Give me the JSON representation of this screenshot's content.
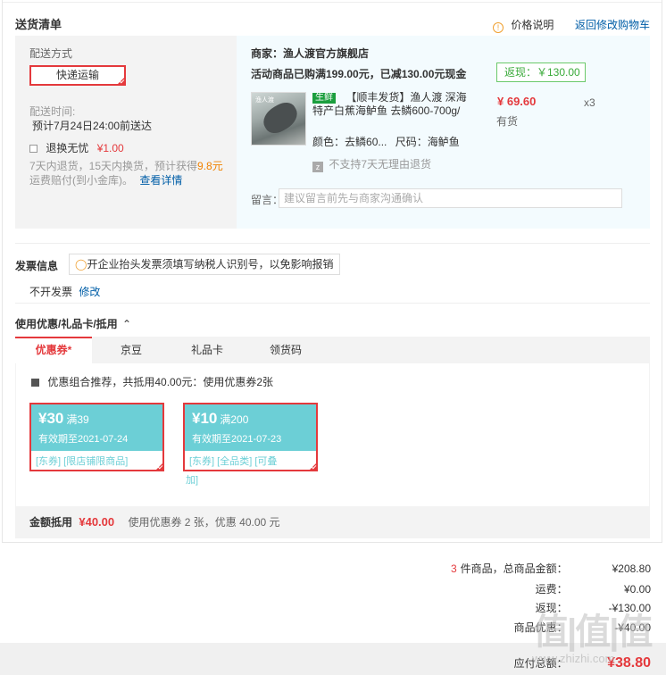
{
  "delivery": {
    "title": "送货清单",
    "price_explain": "价格说明",
    "back_to_cart": "返回修改购物车",
    "ship_method_label": "配送方式",
    "ship_method": "快递运输",
    "ship_time_label": "配送时间:",
    "ship_time": "预计7月24日24:00前送达",
    "worry_free": "退换无忧",
    "worry_free_price": "¥1.00",
    "worry_free_desc_1": "7天内退货，15天内换货，预计获得",
    "worry_free_amount": "9.8元",
    "worry_free_desc_2": "运费赔付(到小金库)。",
    "view_details": "查看详情"
  },
  "merchant": {
    "label": "商家：渔人渡官方旗舰店",
    "promo": "活动商品已购满199.00元，已减130.00元现金",
    "rebate": "返现：￥130.00",
    "product_image_text": "渔人渡",
    "product_tag": "生鲜",
    "product_title_1": "【顺丰发货】渔人渡 深海",
    "product_title_2": "特产白蕉海鲈鱼 去鳞600-700g/",
    "price": "¥ 69.60",
    "quantity": "x3",
    "stock": "有货",
    "color_label": "颜色：",
    "color_value": "去鳞60...",
    "size_label": "尺码：",
    "size_value": "海鲈鱼",
    "no_return": "不支持7天无理由退货",
    "note_label": "留言：",
    "note_placeholder": "建议留言前先与商家沟通确认"
  },
  "invoice": {
    "title": "发票信息",
    "tip": "开企业抬头发票须填写纳税人识别号，以免影响报销",
    "value": "不开发票",
    "modify": "修改"
  },
  "discount": {
    "title": "使用优惠/礼品卡/抵用",
    "tabs": [
      "优惠券*",
      "京豆",
      "礼品卡",
      "领货码"
    ],
    "combo_text": "优惠组合推荐，共抵用40.00元：使用优惠券2张",
    "coupons": [
      {
        "amount": "¥30",
        "cond": "满39",
        "expiry": "有效期至2021-07-24",
        "tags": "[东券]  [限店铺限商品]",
        "tags2": ""
      },
      {
        "amount": "¥10",
        "cond": "满200",
        "expiry": "有效期至2021-07-23",
        "tags": "[东券]  [全品类]  [可叠",
        "tags2": "加]"
      }
    ],
    "sum_label": "金额抵用",
    "sum_value": "¥40.00",
    "sum_desc": "使用优惠券 2 张，优惠 40.00 元"
  },
  "totals": {
    "count": "3",
    "count_label": "件商品，总商品金额：",
    "goods_total": "¥208.80",
    "freight_label": "运费：",
    "freight": "¥0.00",
    "rebate_label": "返现：",
    "rebate": "-¥130.00",
    "discount_label": "商品优惠：",
    "discount": "-¥40.00",
    "payable_label": "应付总额：",
    "payable": "¥38.80"
  },
  "watermark": {
    "text": "值|值|值",
    "url": "www.zhizhi.com"
  },
  "colors": {
    "accent": "#e4393c",
    "link": "#005ea7",
    "coupon": "#6ccfd6",
    "rebate_green": "#3aaa3a"
  }
}
